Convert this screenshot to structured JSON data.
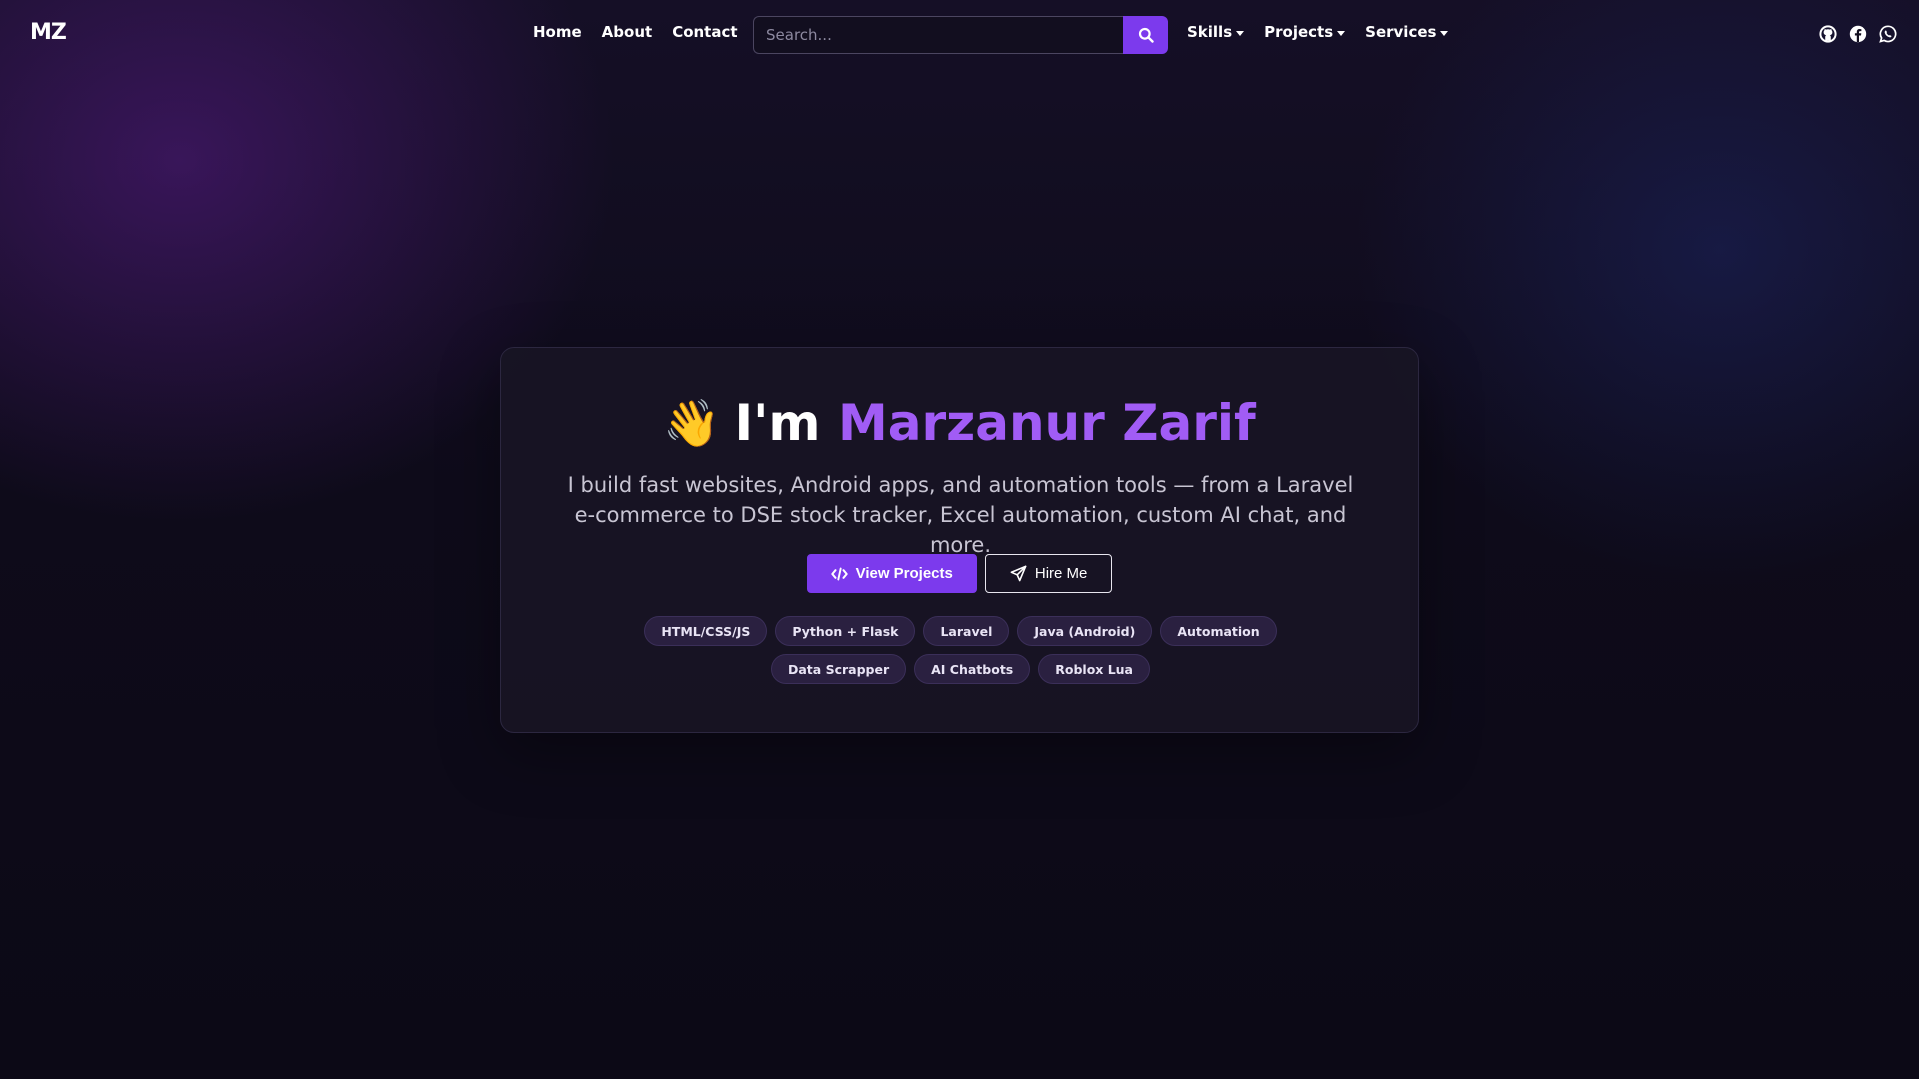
{
  "navbar": {
    "brand": "MZ",
    "links": [
      "Home",
      "About",
      "Contact"
    ],
    "search": {
      "placeholder": "Search...",
      "value": ""
    },
    "dropdowns": [
      "Skills",
      "Projects",
      "Services"
    ],
    "social_icons": [
      "github-icon",
      "facebook-icon",
      "whatsapp-icon"
    ]
  },
  "hero": {
    "emoji": "👋",
    "title_prefix": "I'm",
    "title_name": "Marzanur Zarif",
    "description_line1": "I build fast websites, Android apps, and automation tools — from a Laravel",
    "description_line2": "e-commerce to DSE stock tracker, Excel automation, custom AI chat, and more.",
    "buttons": {
      "view_projects": "View Projects",
      "hire_me": "Hire Me"
    },
    "tags": [
      "HTML/CSS/JS",
      "Python + Flask",
      "Laravel",
      "Java (Android)",
      "Automation",
      "Data Scrapper",
      "AI Chatbots",
      "Roblox Lua"
    ]
  },
  "colors": {
    "accent": "#7c3aed",
    "name_highlight": "#a15cf5",
    "background": "#0d0a18",
    "card": "#181524",
    "tag_bg": "#2a2040"
  }
}
